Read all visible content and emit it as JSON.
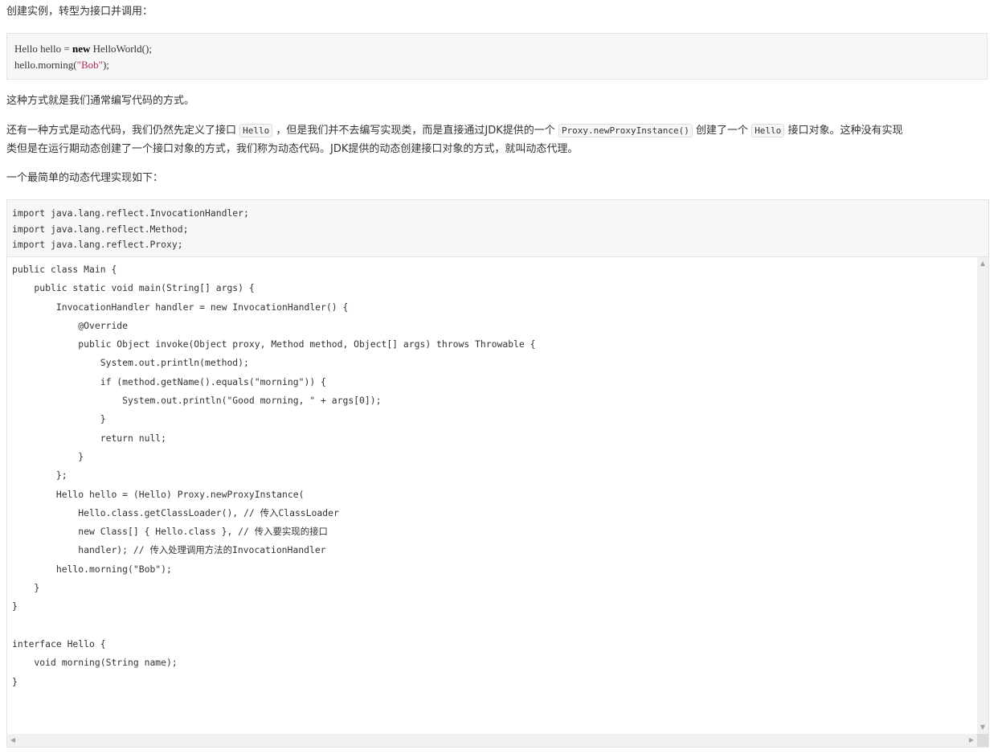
{
  "intro": {
    "line1": "创建实例，转型为接口并调用：",
    "code1": {
      "line1_prefix": "Hello hello = ",
      "line1_kw": "new",
      "line1_suffix": " HelloWorld();",
      "line2_prefix": "hello.morning(",
      "line2_str": "\"Bob\"",
      "line2_suffix": ");"
    },
    "line2": "这种方式就是我们通常编写代码的方式。",
    "para3": {
      "t1": "还有一种方式是动态代码，我们仍然先定义了接口",
      "c1": "Hello",
      "t2": "，但是我们并不去编写实现类，而是直接通过JDK提供的一个",
      "c2": "Proxy.newProxyInstance()",
      "t3": "创建了一个",
      "c3": "Hello",
      "t4": "接口对象。这种没有实现",
      "t5": "类但是在运行期动态创建了一个接口对象的方式，我们称为动态代码。JDK提供的动态创建接口对象的方式，就叫动态代理。"
    },
    "line4": "一个最简单的动态代理实现如下："
  },
  "code2": {
    "imports": [
      "import java.lang.reflect.InvocationHandler;",
      "import java.lang.reflect.Method;",
      "import java.lang.reflect.Proxy;"
    ],
    "lines": [
      "public class Main {",
      "    public static void main(String[] args) {",
      "        InvocationHandler handler = new InvocationHandler() {",
      "            @Override",
      "            public Object invoke(Object proxy, Method method, Object[] args) throws Throwable {",
      "                System.out.println(method);",
      "                if (method.getName().equals(\"morning\")) {",
      "                    System.out.println(\"Good morning, \" + args[0]);",
      "                }",
      "                return null;",
      "            }",
      "        };",
      "        Hello hello = (Hello) Proxy.newProxyInstance(",
      "            Hello.class.getClassLoader(), // 传入ClassLoader",
      "            new Class[] { Hello.class }, // 传入要实现的接口",
      "            handler); // 传入处理调用方法的InvocationHandler",
      "        hello.morning(\"Bob\");",
      "    }",
      "}",
      "",
      "interface Hello {",
      "    void morning(String name);",
      "}"
    ]
  },
  "scrollbar": {
    "up_arrow": "▲",
    "down_arrow": "▼",
    "left_arrow": "◀",
    "right_arrow": "▶"
  }
}
